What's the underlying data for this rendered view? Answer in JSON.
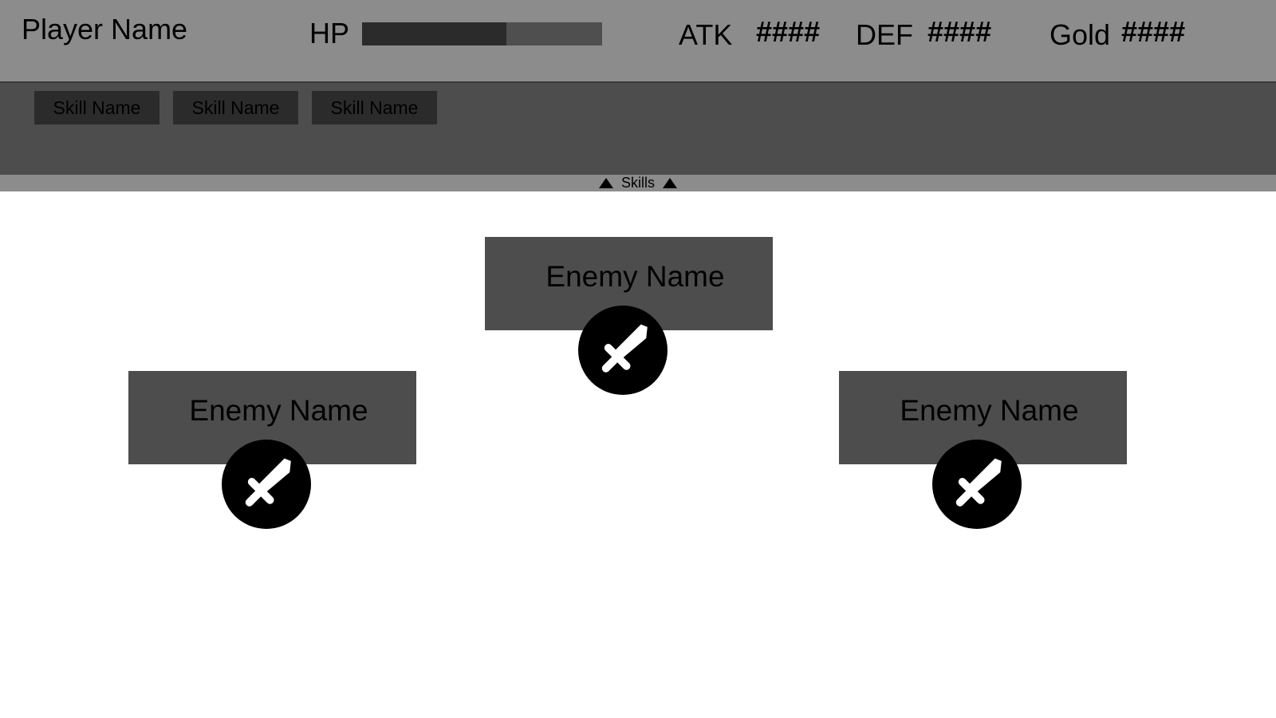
{
  "player": {
    "name": "Player Name",
    "hp_label": "HP",
    "hp_fraction": 0.6
  },
  "stats": {
    "atk_label": "ATK",
    "atk_value": "####",
    "def_label": "DEF",
    "def_value": "####",
    "gold_label": "Gold",
    "gold_value": "####"
  },
  "skills": {
    "items": [
      {
        "label": "Skill Name"
      },
      {
        "label": "Skill Name"
      },
      {
        "label": "Skill Name"
      }
    ],
    "toggle_label": "Skills",
    "toggle_icon": "triangle-up-icon"
  },
  "enemies": [
    {
      "name": "Enemy Name",
      "action_icon": "sword-icon"
    },
    {
      "name": "Enemy Name",
      "action_icon": "sword-icon"
    },
    {
      "name": "Enemy Name",
      "action_icon": "sword-icon"
    }
  ],
  "colors": {
    "hud_bg": "#8c8c8c",
    "panel_bg": "#4d4d4d",
    "hp_fill": "#2b2b2b",
    "hp_track": "#4f4f4f",
    "button_bg": "#2b2b2b"
  }
}
